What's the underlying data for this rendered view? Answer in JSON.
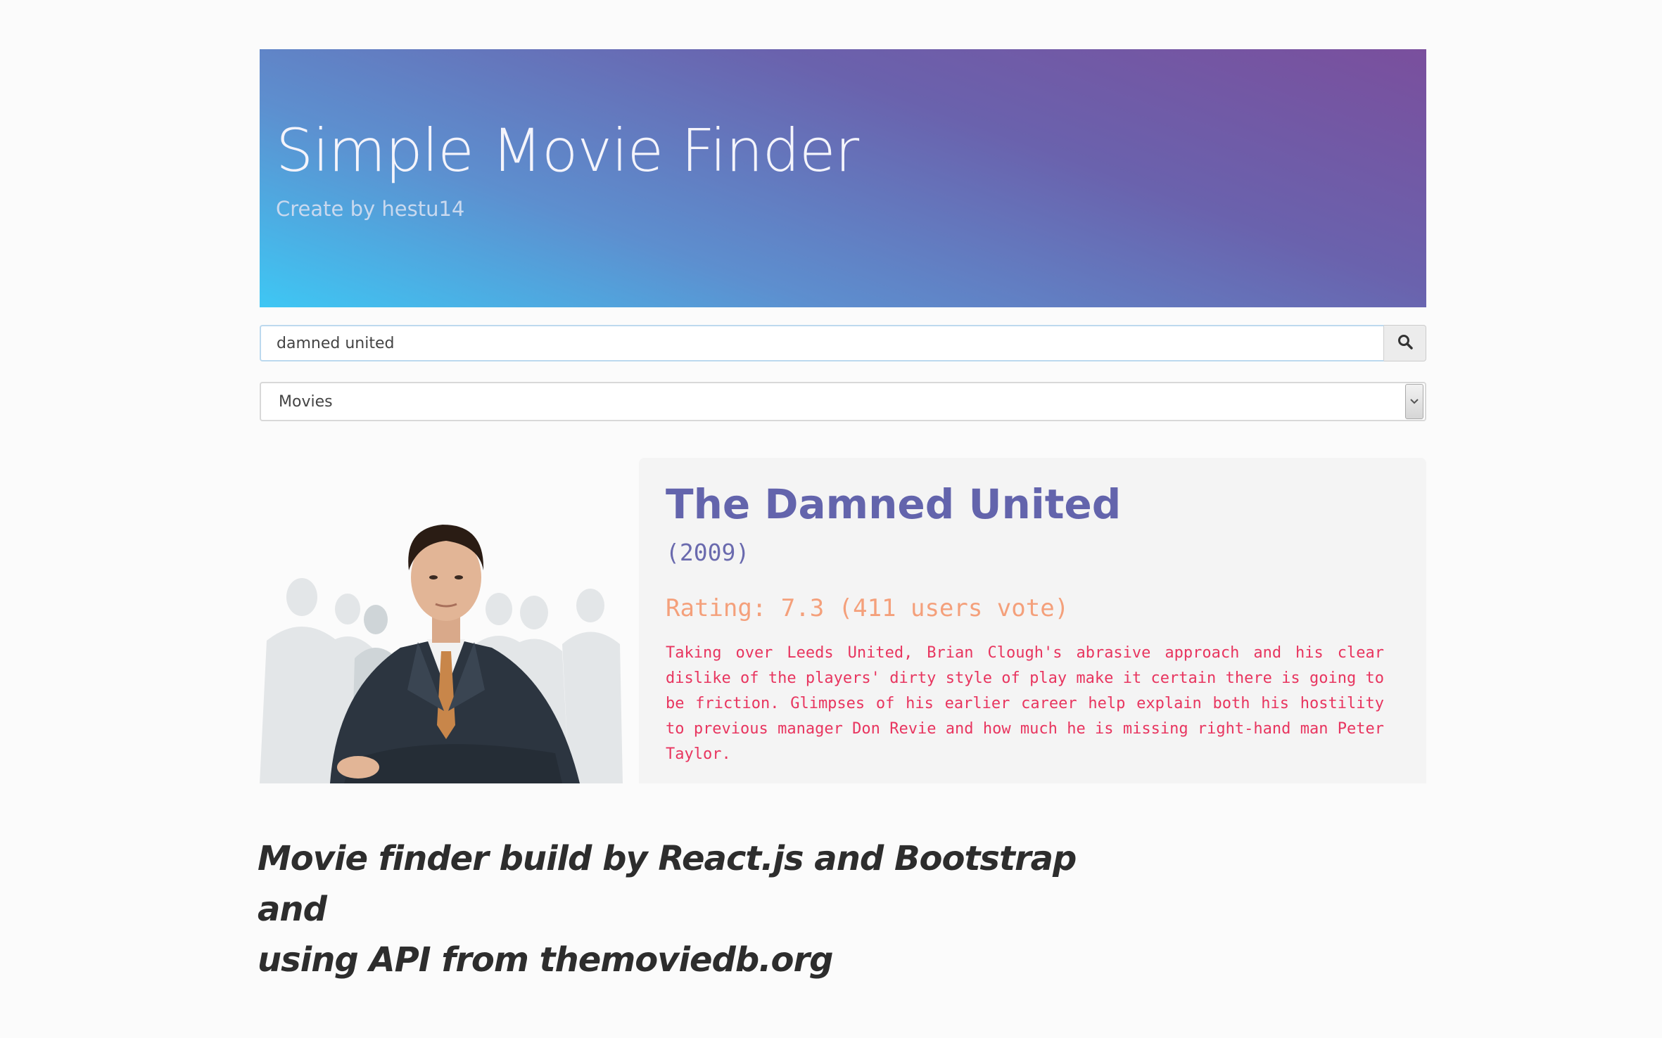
{
  "header": {
    "title": "Simple Movie Finder",
    "subtitle": "Create by hestu14"
  },
  "search": {
    "value": "damned united",
    "button_icon": "search-icon"
  },
  "type_select": {
    "selected": "Movies",
    "arrow_icon": "chevron-down-icon"
  },
  "result": {
    "poster_alt": "poster-image",
    "title": "The Damned United",
    "year": "(2009)",
    "rating": "Rating: 7.3 (411 users vote)",
    "overview": "Taking over Leeds United, Brian Clough's abrasive approach and his clear dislike of the players' dirty style of play make it certain there is going to be friction. Glimpses of his earlier career help explain both his hostility to previous manager Don Revie and how much he is missing right-hand man Peter Taylor."
  },
  "caption": {
    "line1": "Movie finder build by React.js and Bootstrap and",
    "line2": "using API from themoviedb.org"
  },
  "colors": {
    "gradient_start": "#3ec7f4",
    "gradient_end": "#7a4f9d",
    "title": "#6364ac",
    "rating": "#f4a07b",
    "overview": "#e8355f"
  }
}
